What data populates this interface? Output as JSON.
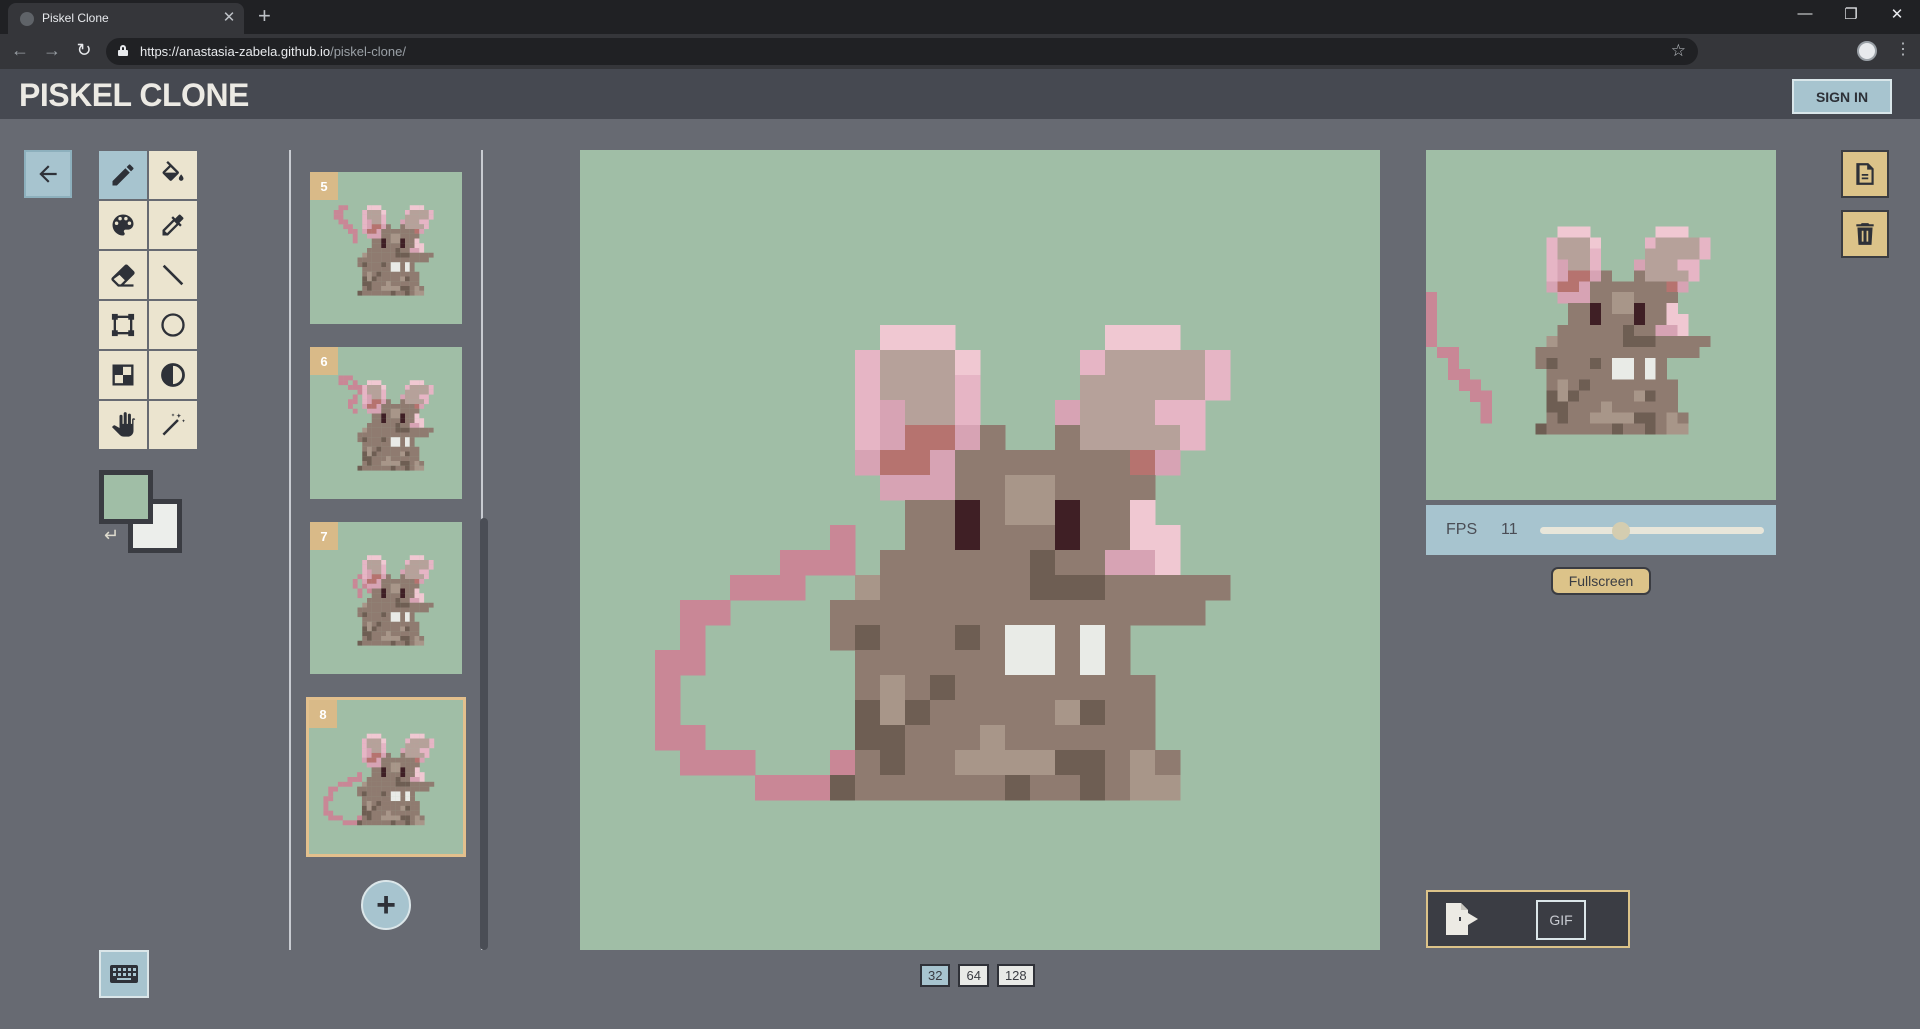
{
  "browser": {
    "tab_title": "Piskel Clone",
    "tab_close": "✕",
    "new_tab": "+",
    "url_host": "https://anastasia-zabela.github.io",
    "url_path": "/piskel-clone/",
    "nav_back": "←",
    "nav_forward": "→",
    "nav_reload": "↻",
    "star": "☆",
    "menu": "⋮",
    "win_minimize": "—",
    "win_restore": "❐",
    "win_close": "✕"
  },
  "header": {
    "title": "PISKEL CLONE",
    "signin_label": "SIGN IN"
  },
  "tools": [
    {
      "name": "pen-tool",
      "icon": "pencil-icon",
      "active": true
    },
    {
      "name": "paint-bucket-tool",
      "icon": "paint-bucket-icon",
      "active": false
    },
    {
      "name": "palette-tool",
      "icon": "palette-icon",
      "active": false
    },
    {
      "name": "eyedropper-tool",
      "icon": "eyedropper-icon",
      "active": false
    },
    {
      "name": "eraser-tool",
      "icon": "eraser-icon",
      "active": false
    },
    {
      "name": "line-tool",
      "icon": "line-icon",
      "active": false
    },
    {
      "name": "rectangle-tool",
      "icon": "rectangle-icon",
      "active": false
    },
    {
      "name": "circle-tool",
      "icon": "circle-icon",
      "active": false
    },
    {
      "name": "dither-tool",
      "icon": "dither-icon",
      "active": false
    },
    {
      "name": "lighten-tool",
      "icon": "contrast-icon",
      "active": false
    },
    {
      "name": "move-tool",
      "icon": "hand-icon",
      "active": false
    },
    {
      "name": "magic-wand-tool",
      "icon": "magic-wand-icon",
      "active": false
    }
  ],
  "colors": {
    "primary": "#a0bea6",
    "secondary": "#eceeeb",
    "swap_icon": "↵"
  },
  "frames": [
    {
      "number": "5",
      "selected": false
    },
    {
      "number": "6",
      "selected": false
    },
    {
      "number": "7",
      "selected": false
    },
    {
      "number": "8",
      "selected": true
    }
  ],
  "add_frame_label": "+",
  "canvas_sizes": [
    {
      "label": "32",
      "active": true
    },
    {
      "label": "64",
      "active": false
    },
    {
      "label": "128",
      "active": false
    }
  ],
  "preview": {
    "fps_label": "FPS",
    "fps_value": "11",
    "fps_fraction": 0.36,
    "fullscreen_label": "Fullscreen"
  },
  "export": {
    "gif_label": "GIF"
  },
  "accent_colors": {
    "canvas_bg": "#a0bea6",
    "tool_bg": "#ebe4cf",
    "active_blue": "#a7c4cf",
    "gold": "#dcc389"
  }
}
